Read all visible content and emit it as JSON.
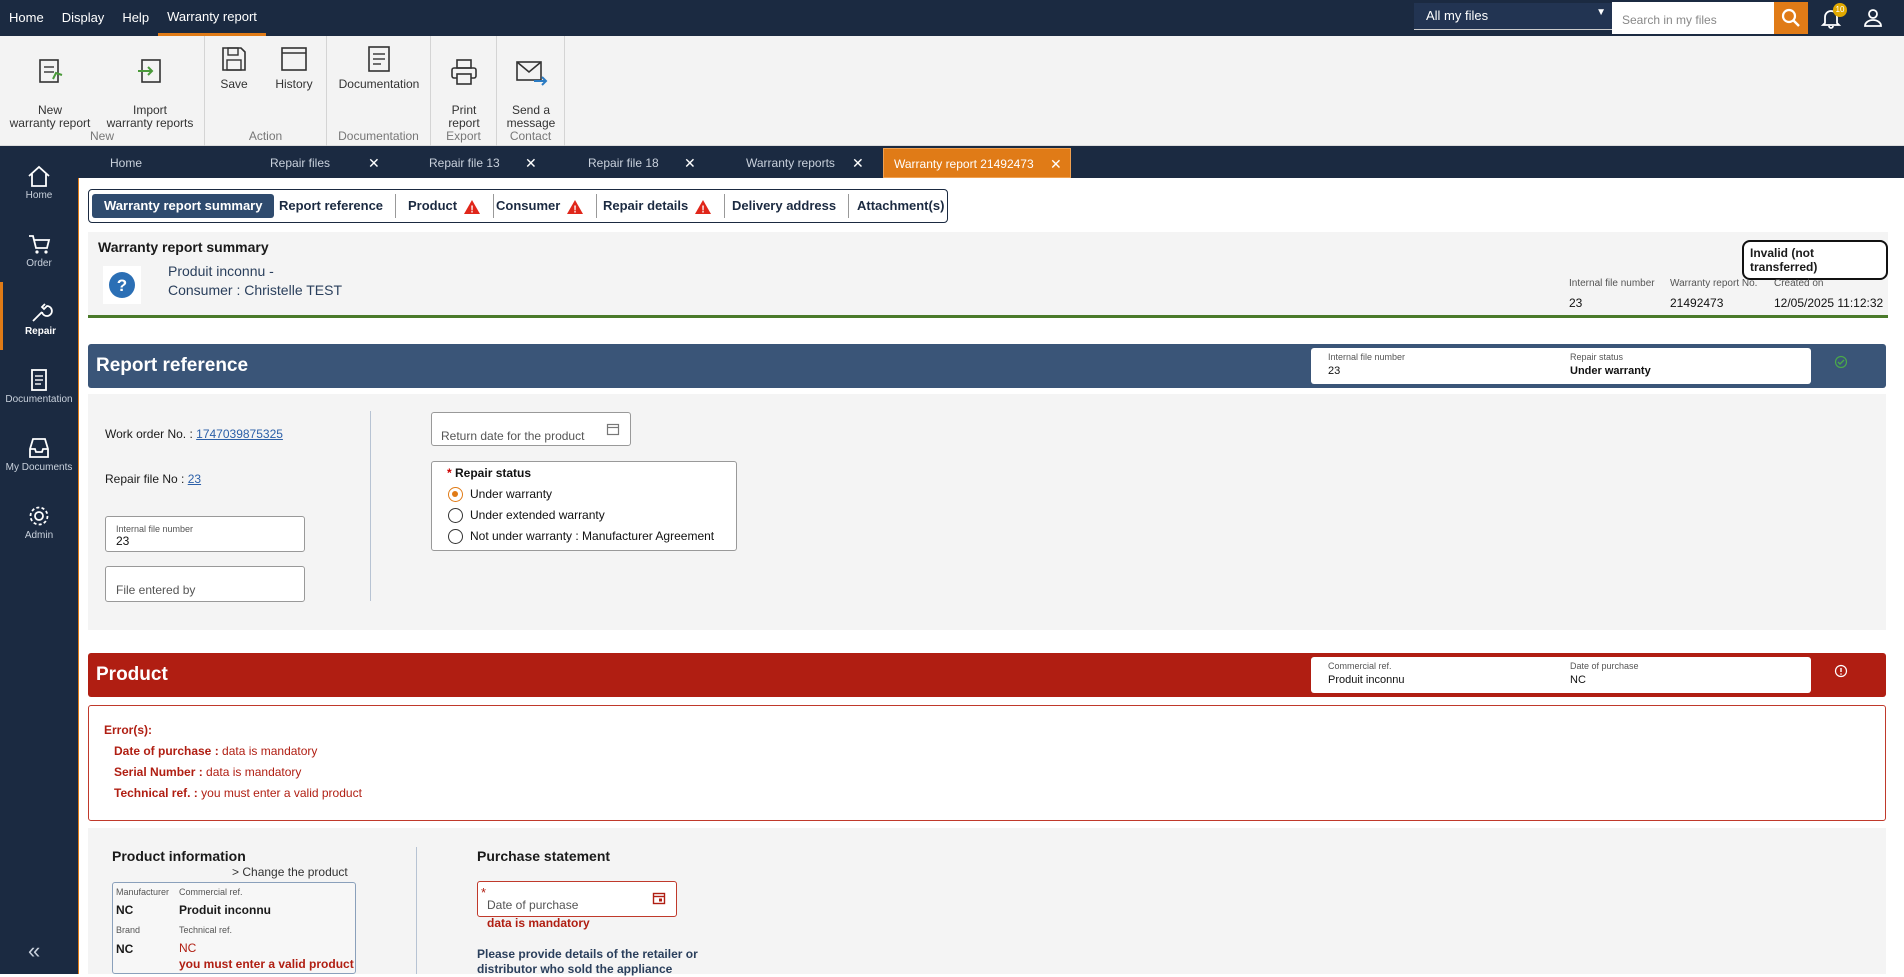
{
  "menu": {
    "items": [
      "Home",
      "Display",
      "Help",
      "Warranty report"
    ]
  },
  "topbar": {
    "files_select": "All my files",
    "search_placeholder": "Search in my files",
    "notif_count": "10"
  },
  "ribbon": {
    "new_label": "New",
    "new_report": "New\nwarranty report",
    "import": "Import\nwarranty reports",
    "action_label": "Action",
    "save": "Save",
    "history": "History",
    "doc_label": "Documentation",
    "documentation": "Documentation",
    "export_label": "Export",
    "print": "Print\nreport",
    "contact_label": "Contact",
    "send": "Send a\nmessage"
  },
  "sidebar": {
    "items": [
      "Home",
      "Order",
      "Repair",
      "Documentation",
      "My Documents",
      "Admin"
    ]
  },
  "tabs": [
    "Home",
    "Repair files",
    "Repair file 13",
    "Repair file 18",
    "Warranty reports",
    "Warranty report 21492473"
  ],
  "subtabs": [
    "Warranty report summary",
    "Report reference",
    "Product",
    "Consumer",
    "Repair details",
    "Delivery address",
    "Attachment(s)"
  ],
  "summary": {
    "title": "Warranty report summary",
    "product": "Produit inconnu -",
    "consumer": "Consumer : Christelle TEST",
    "status": "Invalid (not transferred)",
    "lbl_internal": "Internal file number",
    "val_internal": "23",
    "lbl_report": "Warranty report  No.",
    "val_report": "21492473",
    "lbl_created": "Created on",
    "val_created": "12/05/2025 11:12:32"
  },
  "reference": {
    "title": "Report reference",
    "lbl_internal": "Internal file number",
    "val_internal": "23",
    "lbl_status": "Repair status",
    "val_status": "Under warranty",
    "work_order_lbl": "Work order No. :",
    "work_order": "1747039875325",
    "repair_file_lbl": "Repair file No :",
    "repair_file": "23",
    "internal_field_lbl": "Internal file number",
    "internal_field_val": "23",
    "entered_by": "File  entered by",
    "return_date": "Return date for the product",
    "repair_status_title": "Repair status",
    "required_mark": "*",
    "options": [
      "Under warranty",
      "Under extended warranty",
      "Not under warranty : Manufacturer Agreement"
    ]
  },
  "product": {
    "title": "Product",
    "lbl_comm": "Commercial ref.",
    "val_comm": "Produit inconnu",
    "lbl_date": "Date of purchase",
    "val_date": "NC",
    "errors_title": "Error(s):",
    "errors": [
      {
        "field": "Date of purchase :",
        "msg": "data is mandatory"
      },
      {
        "field": "Serial Number :",
        "msg": "data is mandatory"
      },
      {
        "field": "Technical ref. :",
        "msg": "you must enter a valid product"
      }
    ],
    "info_title": "Product information",
    "change": "Change the product",
    "manufacturer_lbl": "Manufacturer",
    "manufacturer": "NC",
    "commref_lbl": "Commercial ref.",
    "commref": "Produit inconnu",
    "brand_lbl": "Brand",
    "brand": "NC",
    "techref_lbl": "Technical ref.",
    "techref": "NC",
    "techref_err": "you must enter a valid product",
    "purchase_title": "Purchase statement",
    "purchase_date": "Date of purchase",
    "purchase_required": "*",
    "purchase_err": "data is mandatory",
    "retailer_text": "Please provide details of the retailer or distributor who sold the appliance"
  }
}
